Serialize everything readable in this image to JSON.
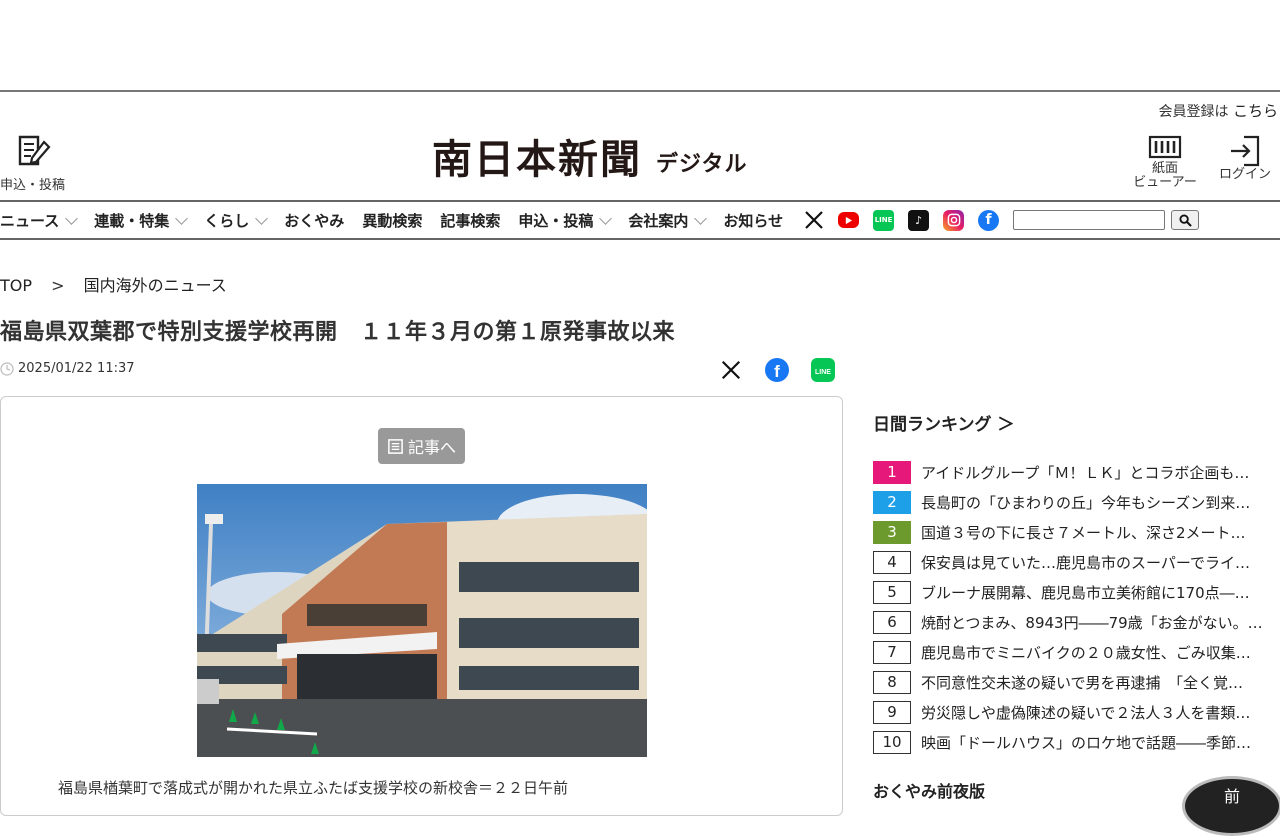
{
  "header": {
    "member_text": "会員登録は",
    "member_link": "こちら",
    "apply_label": "申込・投稿",
    "logo_main": "南日本新聞",
    "logo_sub": "デジタル",
    "viewer_label_1": "紙面",
    "viewer_label_2": "ビューアー",
    "login_label": "ログイン"
  },
  "nav": {
    "items": [
      {
        "label": "ニュース",
        "dropdown": true
      },
      {
        "label": "連載・特集",
        "dropdown": true
      },
      {
        "label": "くらし",
        "dropdown": true
      },
      {
        "label": "おくやみ",
        "dropdown": false
      },
      {
        "label": "異動検索",
        "dropdown": false
      },
      {
        "label": "記事検索",
        "dropdown": false
      },
      {
        "label": "申込・投稿",
        "dropdown": true
      },
      {
        "label": "会社案内",
        "dropdown": true
      },
      {
        "label": "お知らせ",
        "dropdown": false
      }
    ],
    "sns": [
      "x-icon",
      "youtube-icon",
      "line-icon",
      "tiktok-icon",
      "instagram-icon",
      "facebook-icon"
    ],
    "search_placeholder": ""
  },
  "breadcrumb": {
    "top": "TOP",
    "separator": ">",
    "current": "国内海外のニュース"
  },
  "article": {
    "title": "福島県双葉郡で特別支援学校再開　１１年３月の第１原発事故以来",
    "date": "2025/01/22 11:37",
    "to_article_label": "記事へ",
    "caption": "福島県楢葉町で落成式が開かれた県立ふたば支援学校の新校舎＝２２日午前"
  },
  "ranking": {
    "title": "日間ランキング ＞",
    "items": [
      {
        "rank": "1",
        "color": "#e6197a",
        "text": "アイドルグループ「Ｍ！ＬＫ」とコラボ企画も…"
      },
      {
        "rank": "2",
        "color": "#1ea0e8",
        "text": "長島町の「ひまわりの丘」今年もシーズン到来…"
      },
      {
        "rank": "3",
        "color": "#6d9a2c",
        "text": "国道３号の下に長さ７メートル、深さ2メート…"
      },
      {
        "rank": "4",
        "color": "",
        "text": "保安員は見ていた…鹿児島市のスーパーでライ…"
      },
      {
        "rank": "5",
        "color": "",
        "text": "ブルーナ展開幕、鹿児島市立美術館に170点―…"
      },
      {
        "rank": "6",
        "color": "",
        "text": "焼酎とつまみ、8943円――79歳「お金がない。…"
      },
      {
        "rank": "7",
        "color": "",
        "text": "鹿児島市でミニバイクの２０歳女性、ごみ収集…"
      },
      {
        "rank": "8",
        "color": "",
        "text": "不同意性交未遂の疑いで男を再逮捕　「全く覚…"
      },
      {
        "rank": "9",
        "color": "",
        "text": "労災隠しや虚偽陳述の疑いで２法人３人を書類…"
      },
      {
        "rank": "10",
        "color": "",
        "text": "映画「ドールハウス」のロケ地で話題――季節…"
      }
    ]
  },
  "obituary": {
    "title": "おくやみ前夜版",
    "badge": "前"
  }
}
